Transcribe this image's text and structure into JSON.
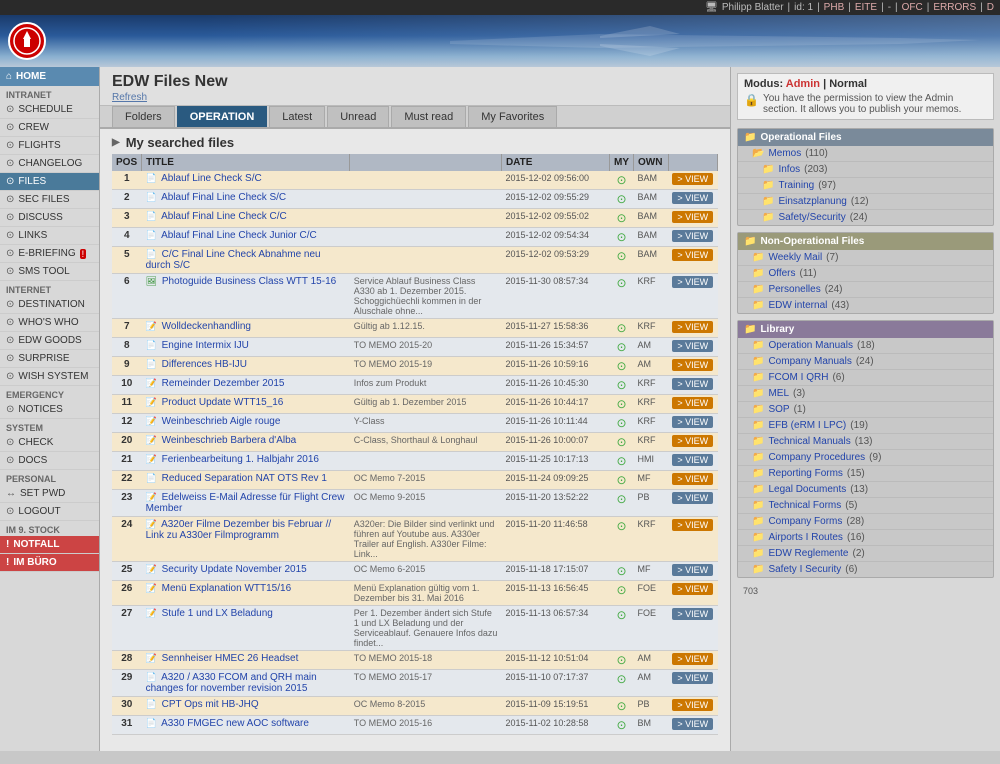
{
  "topbar": {
    "user": "Philipp Blatter",
    "id": "id: 1",
    "items": [
      "PHB",
      "EITE",
      "-",
      "OFC",
      "ERRORS",
      "D"
    ]
  },
  "header": {
    "logo_text": "✦"
  },
  "sidebar": {
    "home_label": "HOME",
    "sections": [
      {
        "label": "INTRANET",
        "items": [
          {
            "id": "schedule",
            "icon": "⊙",
            "label": "SCHEDULE"
          },
          {
            "id": "crew",
            "icon": "⊙",
            "label": "CREW"
          },
          {
            "id": "flights",
            "icon": "⊙",
            "label": "FLIGHTS",
            "active": false
          },
          {
            "id": "changelog",
            "icon": "⊙",
            "label": "CHANGELOG"
          },
          {
            "id": "files",
            "icon": "⊙",
            "label": "FILES",
            "active": true
          },
          {
            "id": "secfiles",
            "icon": "⊙",
            "label": "SEC FILES"
          },
          {
            "id": "discuss",
            "icon": "⊙",
            "label": "DISCUSS"
          },
          {
            "id": "links",
            "icon": "⊙",
            "label": "LINKS"
          },
          {
            "id": "ebriefing",
            "icon": "⊙",
            "label": "E-BRIEFING",
            "badge": "!"
          },
          {
            "id": "smstool",
            "icon": "⊙",
            "label": "SMS TOOL"
          }
        ]
      },
      {
        "label": "INTERNET",
        "items": [
          {
            "id": "destination",
            "icon": "⊙",
            "label": "DESTINATION"
          },
          {
            "id": "whoswho",
            "icon": "⊙",
            "label": "WHO'S WHO"
          },
          {
            "id": "edwgoods",
            "icon": "⊙",
            "label": "EDW GOODS"
          },
          {
            "id": "surprise",
            "icon": "⊙",
            "label": "SURPRISE"
          },
          {
            "id": "wishsystem",
            "icon": "⊙",
            "label": "WISH SYSTEM"
          }
        ]
      },
      {
        "label": "EMERGENCY",
        "items": [
          {
            "id": "notices",
            "icon": "⊙",
            "label": "NOTICES"
          }
        ]
      },
      {
        "label": "SYSTEM",
        "items": [
          {
            "id": "check",
            "icon": "⊙",
            "label": "CHECK"
          },
          {
            "id": "docs",
            "icon": "⊙",
            "label": "DOCS"
          }
        ]
      },
      {
        "label": "PERSONAL",
        "items": [
          {
            "id": "setpwd",
            "icon": "↔",
            "label": "SET PWD"
          },
          {
            "id": "logout",
            "icon": "⊙",
            "label": "LOGOUT"
          }
        ]
      },
      {
        "label": "IM 9. STOCK",
        "items": [
          {
            "id": "notfall",
            "icon": "!",
            "label": "NOTFALL",
            "special": "notfall"
          },
          {
            "id": "imbuero",
            "icon": "!",
            "label": "IM BÜRO",
            "special": "bureau"
          }
        ]
      }
    ]
  },
  "content": {
    "title": "EDW Files New",
    "refresh": "Refresh",
    "tabs": [
      {
        "id": "folders",
        "label": "Folders"
      },
      {
        "id": "operation",
        "label": "OPERATION",
        "active": true
      },
      {
        "id": "latest",
        "label": "Latest"
      },
      {
        "id": "unread",
        "label": "Unread"
      },
      {
        "id": "mustread",
        "label": "Must read"
      },
      {
        "id": "myfavorites",
        "label": "My Favorites"
      }
    ],
    "section_title": "My searched files",
    "table_headers": [
      "POS",
      "TITLE",
      "",
      "DATE",
      "MY",
      "OWN",
      ""
    ],
    "rows": [
      {
        "pos": "1",
        "title": "Ablauf Line Check S/C",
        "type": "pdf",
        "desc": "",
        "date": "2015-12-02 09:56:00",
        "my": "green",
        "own": "BAM",
        "view": "VIEW",
        "orange": true
      },
      {
        "pos": "2",
        "title": "Ablauf Final Line Check S/C",
        "type": "pdf",
        "desc": "",
        "date": "2015-12-02 09:55:29",
        "my": "green",
        "own": "BAM",
        "view": "VIEW",
        "orange": false
      },
      {
        "pos": "3",
        "title": "Ablauf Final Line Check C/C",
        "type": "pdf",
        "desc": "",
        "date": "2015-12-02 09:55:02",
        "my": "green",
        "own": "BAM",
        "view": "VIEW",
        "orange": true
      },
      {
        "pos": "4",
        "title": "Ablauf Final Line Check Junior C/C",
        "type": "pdf",
        "desc": "",
        "date": "2015-12-02 09:54:34",
        "my": "green",
        "own": "BAM",
        "view": "VIEW",
        "orange": false
      },
      {
        "pos": "5",
        "title": "C/C Final Line Check Abnahme neu durch S/C",
        "type": "pdf",
        "desc": "",
        "date": "2015-12-02 09:53:29",
        "my": "green",
        "own": "BAM",
        "view": "VIEW",
        "orange": true
      },
      {
        "pos": "6",
        "title": "Photoguide Business Class WTT 15-16",
        "type": "img",
        "desc": "Service Ablauf Business Class A330 ab 1. Dezember 2015. Schoggichüechli kommen in der Aluschale ohne...",
        "date": "2015-11-30 08:57:34",
        "my": "green",
        "own": "KRF",
        "view": "VIEW",
        "orange": false
      },
      {
        "pos": "7",
        "title": "Wolldeckenhandling",
        "type": "word",
        "desc": "Gültig ab 1.12.15.",
        "date": "2015-11-27 15:58:36",
        "my": "green",
        "own": "KRF",
        "view": "VIEW",
        "orange": true
      },
      {
        "pos": "8",
        "title": "Engine Intermix IJU",
        "type": "pdf",
        "desc": "TO MEMO 2015-20",
        "date": "2015-11-26 15:34:57",
        "my": "green",
        "own": "AM",
        "view": "VIEW",
        "orange": false
      },
      {
        "pos": "9",
        "title": "Differences HB-IJU",
        "type": "pdf",
        "desc": "TO MEMO 2015-19",
        "date": "2015-11-26 10:59:16",
        "my": "green",
        "own": "AM",
        "view": "VIEW",
        "orange": true
      },
      {
        "pos": "10",
        "title": "Remeinder Dezember 2015",
        "type": "word",
        "desc": "Infos zum Produkt",
        "date": "2015-11-26 10:45:30",
        "my": "green",
        "own": "KRF",
        "view": "VIEW",
        "orange": false
      },
      {
        "pos": "11",
        "title": "Product Update WTT15_16",
        "type": "word",
        "desc": "Gültig ab 1. Dezember 2015",
        "date": "2015-11-26 10:44:17",
        "my": "green",
        "own": "KRF",
        "view": "VIEW",
        "orange": true
      },
      {
        "pos": "12",
        "title": "Weinbeschrieb Aigle rouge",
        "type": "word",
        "desc": "Y-Class",
        "date": "2015-11-26 10:11:44",
        "my": "green",
        "own": "KRF",
        "view": "VIEW",
        "orange": false
      },
      {
        "pos": "20",
        "title": "Weinbeschrieb Barbera d'Alba",
        "type": "word",
        "desc": "C-Class, Shorthaul & Longhaul",
        "date": "2015-11-26 10:00:07",
        "my": "green",
        "own": "KRF",
        "view": "VIEW",
        "orange": true
      },
      {
        "pos": "21",
        "title": "Ferienbearbeitung 1. Halbjahr 2016",
        "type": "word",
        "desc": "",
        "date": "2015-11-25 10:17:13",
        "my": "green",
        "own": "HMI",
        "view": "VIEW",
        "orange": false
      },
      {
        "pos": "22",
        "title": "Reduced Separation NAT OTS Rev 1",
        "type": "pdf",
        "desc": "OC Memo 7-2015",
        "date": "2015-11-24 09:09:25",
        "my": "green",
        "own": "MF",
        "view": "VIEW",
        "orange": true
      },
      {
        "pos": "23",
        "title": "Edelweiss E-Mail Adresse für Flight Crew Member",
        "type": "word",
        "desc": "OC Memo 9-2015",
        "date": "2015-11-20 13:52:22",
        "my": "green",
        "own": "PB",
        "view": "VIEW",
        "orange": false
      },
      {
        "pos": "24",
        "title": "A320er Filme Dezember bis Februar // Link zu A330er Filmprogramm",
        "type": "word",
        "desc": "A320er: Die Bilder sind verlinkt und führen auf Youtube aus. A330er Trailer auf English. A330er Filme: Link...",
        "date": "2015-11-20 11:46:58",
        "my": "green",
        "own": "KRF",
        "view": "VIEW",
        "orange": true
      },
      {
        "pos": "25",
        "title": "Security Update November 2015",
        "type": "word",
        "desc": "OC Memo 6-2015",
        "date": "2015-11-18 17:15:07",
        "my": "green",
        "own": "MF",
        "view": "VIEW",
        "orange": false
      },
      {
        "pos": "26",
        "title": "Menü Explanation WTT15/16",
        "type": "word",
        "desc": "Menü Explanation gültig vom 1. Dezember bis 31. Mai 2016",
        "date": "2015-11-13 16:56:45",
        "my": "green",
        "own": "FOE",
        "view": "VIEW",
        "orange": true
      },
      {
        "pos": "27",
        "title": "Stufe 1 und LX Beladung",
        "type": "word",
        "desc": "Per 1. Dezember ändert sich Stufe 1 und LX Beladung und der Serviceablauf. Genauere Infos dazu findet...",
        "date": "2015-11-13 06:57:34",
        "my": "green",
        "own": "FOE",
        "view": "VIEW",
        "orange": false
      },
      {
        "pos": "28",
        "title": "Sennheiser HMEC 26 Headset",
        "type": "word",
        "desc": "TO MEMO 2015-18",
        "date": "2015-11-12 10:51:04",
        "my": "green",
        "own": "AM",
        "view": "VIEW",
        "orange": true
      },
      {
        "pos": "29",
        "title": "A320 / A330 FCOM and QRH main changes for november revision 2015",
        "type": "pdf",
        "desc": "TO MEMO 2015-17",
        "date": "2015-11-10 07:17:37",
        "my": "green",
        "own": "AM",
        "view": "VIEW",
        "orange": false
      },
      {
        "pos": "30",
        "title": "CPT Ops mit HB-JHQ",
        "type": "pdf",
        "desc": "OC Memo 8-2015",
        "date": "2015-11-09 15:19:51",
        "my": "green",
        "own": "PB",
        "view": "VIEW",
        "orange": true
      },
      {
        "pos": "31",
        "title": "A330 FMGEC new AOC software",
        "type": "pdf",
        "desc": "TO MEMO 2015-16",
        "date": "2015-11-02 10:28:58",
        "my": "green",
        "own": "BM",
        "view": "VIEW",
        "orange": false
      }
    ]
  },
  "rightpanel": {
    "modus_label": "Modus:",
    "admin_text": "Admin",
    "normal_text": "Normal",
    "permission_text": "You have the permission to view the Admin section. It allows you to publish your memos.",
    "operational": {
      "title": "Operational Files",
      "items": [
        {
          "label": "Memos",
          "count": "(110)",
          "sub": [
            {
              "label": "Infos",
              "count": "(203)"
            },
            {
              "label": "Training",
              "count": "(97)"
            },
            {
              "label": "Einsatzplanung",
              "count": "(12)"
            },
            {
              "label": "Safety/Security",
              "count": "(24)"
            }
          ]
        }
      ]
    },
    "nonop": {
      "title": "Non-Operational Files",
      "items": [
        {
          "label": "Weekly Mail",
          "count": "(7)"
        },
        {
          "label": "Offers",
          "count": "(11)"
        },
        {
          "label": "Personelles",
          "count": "(24)"
        },
        {
          "label": "EDW internal",
          "count": "(43)"
        }
      ]
    },
    "library": {
      "title": "Library",
      "items": [
        {
          "label": "Operation Manuals",
          "count": "(18)"
        },
        {
          "label": "Company Manuals",
          "count": "(24)"
        },
        {
          "label": "FCOM I QRH",
          "count": "(6)"
        },
        {
          "label": "MEL",
          "count": "(3)"
        },
        {
          "label": "SOP",
          "count": "(1)"
        },
        {
          "label": "EFB (eRM I LPC)",
          "count": "(19)"
        },
        {
          "label": "Technical Manuals",
          "count": "(13)"
        },
        {
          "label": "Company Procedures",
          "count": "(9)"
        },
        {
          "label": "Reporting Forms",
          "count": "(15)"
        },
        {
          "label": "Legal Documents",
          "count": "(13)"
        },
        {
          "label": "Technical Forms",
          "count": "(5)"
        },
        {
          "label": "Company Forms",
          "count": "(28)"
        },
        {
          "label": "Airports I Routes",
          "count": "(16)"
        },
        {
          "label": "EDW Reglemente",
          "count": "(2)"
        },
        {
          "label": "Safety I Security",
          "count": "(6)"
        }
      ]
    },
    "counter": "703"
  }
}
